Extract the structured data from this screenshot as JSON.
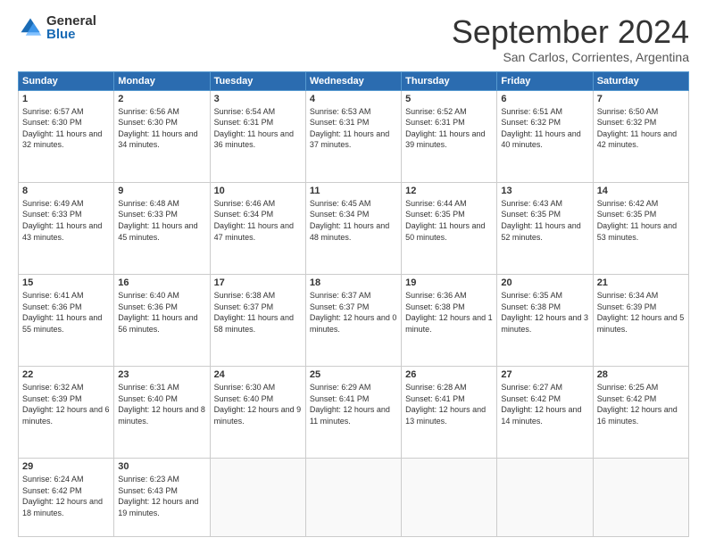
{
  "logo": {
    "general": "General",
    "blue": "Blue"
  },
  "title": "September 2024",
  "location": "San Carlos, Corrientes, Argentina",
  "days_of_week": [
    "Sunday",
    "Monday",
    "Tuesday",
    "Wednesday",
    "Thursday",
    "Friday",
    "Saturday"
  ],
  "weeks": [
    [
      {
        "day": "1",
        "sunrise": "6:57 AM",
        "sunset": "6:30 PM",
        "daylight": "11 hours and 32 minutes."
      },
      {
        "day": "2",
        "sunrise": "6:56 AM",
        "sunset": "6:30 PM",
        "daylight": "11 hours and 34 minutes."
      },
      {
        "day": "3",
        "sunrise": "6:54 AM",
        "sunset": "6:31 PM",
        "daylight": "11 hours and 36 minutes."
      },
      {
        "day": "4",
        "sunrise": "6:53 AM",
        "sunset": "6:31 PM",
        "daylight": "11 hours and 37 minutes."
      },
      {
        "day": "5",
        "sunrise": "6:52 AM",
        "sunset": "6:31 PM",
        "daylight": "11 hours and 39 minutes."
      },
      {
        "day": "6",
        "sunrise": "6:51 AM",
        "sunset": "6:32 PM",
        "daylight": "11 hours and 40 minutes."
      },
      {
        "day": "7",
        "sunrise": "6:50 AM",
        "sunset": "6:32 PM",
        "daylight": "11 hours and 42 minutes."
      }
    ],
    [
      {
        "day": "8",
        "sunrise": "6:49 AM",
        "sunset": "6:33 PM",
        "daylight": "11 hours and 43 minutes."
      },
      {
        "day": "9",
        "sunrise": "6:48 AM",
        "sunset": "6:33 PM",
        "daylight": "11 hours and 45 minutes."
      },
      {
        "day": "10",
        "sunrise": "6:46 AM",
        "sunset": "6:34 PM",
        "daylight": "11 hours and 47 minutes."
      },
      {
        "day": "11",
        "sunrise": "6:45 AM",
        "sunset": "6:34 PM",
        "daylight": "11 hours and 48 minutes."
      },
      {
        "day": "12",
        "sunrise": "6:44 AM",
        "sunset": "6:35 PM",
        "daylight": "11 hours and 50 minutes."
      },
      {
        "day": "13",
        "sunrise": "6:43 AM",
        "sunset": "6:35 PM",
        "daylight": "11 hours and 52 minutes."
      },
      {
        "day": "14",
        "sunrise": "6:42 AM",
        "sunset": "6:35 PM",
        "daylight": "11 hours and 53 minutes."
      }
    ],
    [
      {
        "day": "15",
        "sunrise": "6:41 AM",
        "sunset": "6:36 PM",
        "daylight": "11 hours and 55 minutes."
      },
      {
        "day": "16",
        "sunrise": "6:40 AM",
        "sunset": "6:36 PM",
        "daylight": "11 hours and 56 minutes."
      },
      {
        "day": "17",
        "sunrise": "6:38 AM",
        "sunset": "6:37 PM",
        "daylight": "11 hours and 58 minutes."
      },
      {
        "day": "18",
        "sunrise": "6:37 AM",
        "sunset": "6:37 PM",
        "daylight": "12 hours and 0 minutes."
      },
      {
        "day": "19",
        "sunrise": "6:36 AM",
        "sunset": "6:38 PM",
        "daylight": "12 hours and 1 minute."
      },
      {
        "day": "20",
        "sunrise": "6:35 AM",
        "sunset": "6:38 PM",
        "daylight": "12 hours and 3 minutes."
      },
      {
        "day": "21",
        "sunrise": "6:34 AM",
        "sunset": "6:39 PM",
        "daylight": "12 hours and 5 minutes."
      }
    ],
    [
      {
        "day": "22",
        "sunrise": "6:32 AM",
        "sunset": "6:39 PM",
        "daylight": "12 hours and 6 minutes."
      },
      {
        "day": "23",
        "sunrise": "6:31 AM",
        "sunset": "6:40 PM",
        "daylight": "12 hours and 8 minutes."
      },
      {
        "day": "24",
        "sunrise": "6:30 AM",
        "sunset": "6:40 PM",
        "daylight": "12 hours and 9 minutes."
      },
      {
        "day": "25",
        "sunrise": "6:29 AM",
        "sunset": "6:41 PM",
        "daylight": "12 hours and 11 minutes."
      },
      {
        "day": "26",
        "sunrise": "6:28 AM",
        "sunset": "6:41 PM",
        "daylight": "12 hours and 13 minutes."
      },
      {
        "day": "27",
        "sunrise": "6:27 AM",
        "sunset": "6:42 PM",
        "daylight": "12 hours and 14 minutes."
      },
      {
        "day": "28",
        "sunrise": "6:25 AM",
        "sunset": "6:42 PM",
        "daylight": "12 hours and 16 minutes."
      }
    ],
    [
      {
        "day": "29",
        "sunrise": "6:24 AM",
        "sunset": "6:42 PM",
        "daylight": "12 hours and 18 minutes."
      },
      {
        "day": "30",
        "sunrise": "6:23 AM",
        "sunset": "6:43 PM",
        "daylight": "12 hours and 19 minutes."
      },
      null,
      null,
      null,
      null,
      null
    ]
  ]
}
